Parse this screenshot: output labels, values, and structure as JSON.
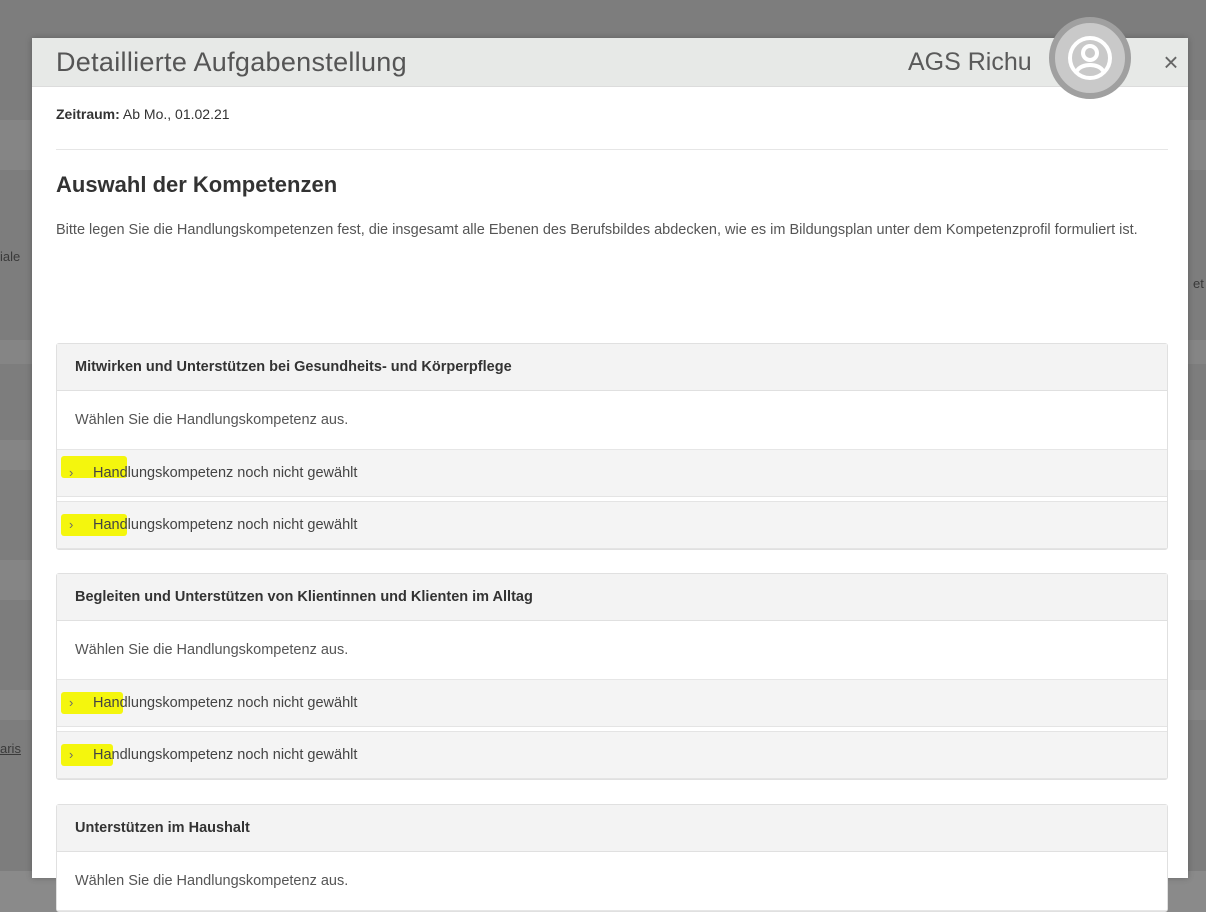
{
  "background": {
    "fragments": [
      "iale",
      "et",
      "aris"
    ]
  },
  "modal": {
    "title": "Detaillierte Aufgabenstellung",
    "user_name": "AGS Richu",
    "close_label": "×",
    "avatar_icon": "user-circle-icon"
  },
  "period": {
    "label": "Zeitraum:",
    "value": "Ab Mo., 01.02.21"
  },
  "section": {
    "title": "Auswahl der Kompetenzen",
    "description": "Bitte legen Sie die Handlungskompetenzen fest, die insgesamt alle Ebenen des Berufsbildes abdecken, wie es im Bildungsplan unter dem Kompetenzprofil formuliert ist."
  },
  "panels": [
    {
      "title": "Mitwirken und Unterstützen bei Gesundheits- und Körperpflege",
      "hint": "Wählen Sie die Handlungskompetenz aus.",
      "items": [
        "Handlungskompetenz noch nicht gewählt",
        "Handlungskompetenz noch nicht gewählt"
      ]
    },
    {
      "title": "Begleiten und Unterstützen von Klientinnen und Klienten im Alltag",
      "hint": "Wählen Sie die Handlungskompetenz aus.",
      "items": [
        "Handlungskompetenz noch nicht gewählt",
        "Handlungskompetenz noch nicht gewählt"
      ]
    },
    {
      "title": "Unterstützen im Haushalt",
      "hint": "Wählen Sie die Handlungskompetenz aus.",
      "items": []
    }
  ],
  "colors": {
    "highlight": "#f3f500",
    "overlay": "#7d7d7d"
  },
  "icons": {
    "chevron": "chevron-right-icon"
  }
}
